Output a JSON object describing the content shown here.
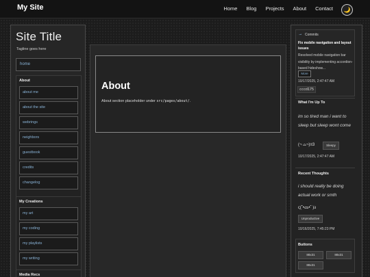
{
  "header": {
    "site_name": "My Site",
    "nav": [
      "Home",
      "Blog",
      "Projects",
      "About",
      "Contact"
    ],
    "theme_toggle_glyph": "🌙"
  },
  "left_sidebar": {
    "title": "Site Title",
    "tagline": "Tagline goes here",
    "home_link": "home",
    "groups": [
      {
        "heading": "About",
        "items": [
          "about me",
          "about the site",
          "webrings",
          "neighbors",
          "guestbook",
          "credits",
          "changelog"
        ]
      },
      {
        "heading": "My Creations",
        "items": [
          "my art",
          "my coding",
          "my playlists",
          "my writing"
        ]
      },
      {
        "heading": "Media Recs",
        "items": []
      }
    ]
  },
  "main": {
    "title": "About",
    "text_before": "About section placeholder under ",
    "text_code": "src/pages/about/",
    "text_after": "."
  },
  "right_sidebar": {
    "commits": {
      "icon": "commit-icon",
      "heading": "Commits",
      "title": "Fix mobile navigation and layout issues",
      "body": "Resolved mobile navigation bar visibility by implementing accordion-based hideshow...",
      "more_label": "More",
      "timestamp": "10/17/2025, 2:47:47 AM",
      "sha": "cccd175"
    },
    "up_to": {
      "heading": "What I'm Up To",
      "text": "im so tired man i want to sleep but sleep wont come",
      "emoticon": "(¬ ⌓¬)≡3",
      "mood": "Sleepy",
      "timestamp": "10/17/2025, 2:47:47 AM"
    },
    "thoughts": {
      "heading": "Recent Thoughts",
      "text": "i should really be doing actual work or smth",
      "emoticon": "ς(˘•ᯅ•˘ )ა",
      "mood": "Unproductive",
      "timestamp": "10/16/2025, 7:45:23 PM"
    },
    "buttons": {
      "heading": "Buttons",
      "items": [
        "88x31",
        "88x31",
        "88x31"
      ]
    }
  }
}
